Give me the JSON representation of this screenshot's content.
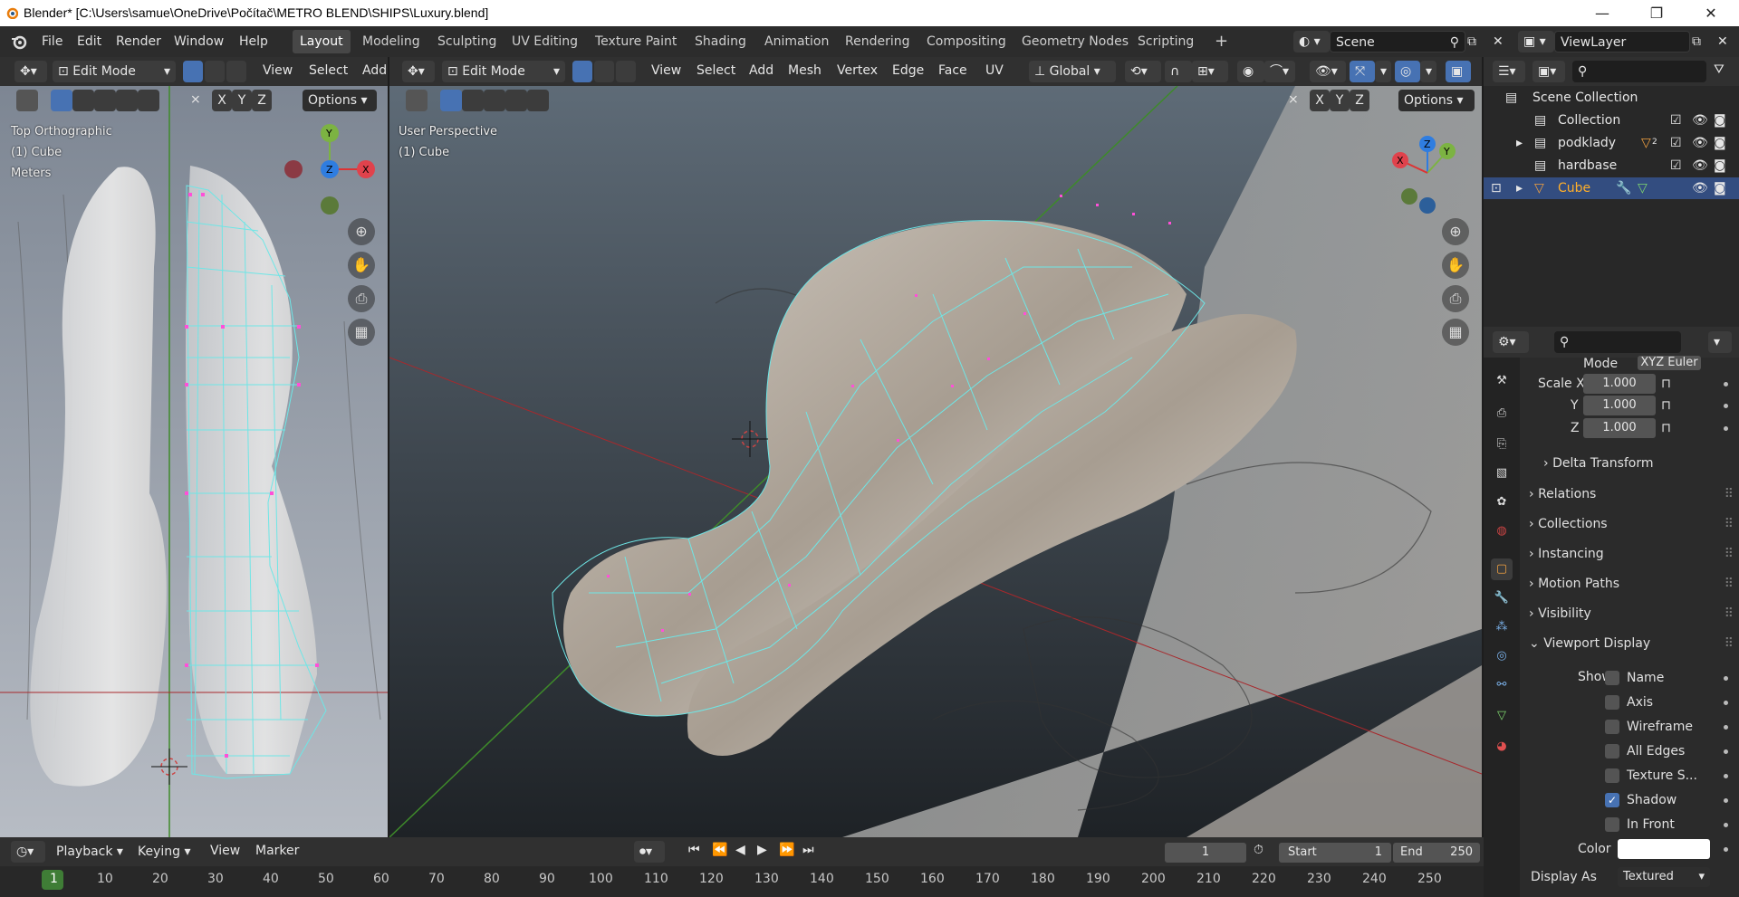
{
  "window": {
    "title": "Blender* [C:\\Users\\samue\\OneDrive\\Počítač\\METRO BLEND\\SHIPS\\Luxury.blend]",
    "controls": [
      "—",
      "❐",
      "✕"
    ]
  },
  "menu": [
    "File",
    "Edit",
    "Render",
    "Window",
    "Help"
  ],
  "workspaces": [
    "Layout",
    "Modeling",
    "Sculpting",
    "UV Editing",
    "Texture Paint",
    "Shading",
    "Animation",
    "Rendering",
    "Compositing",
    "Geometry Nodes",
    "Scripting",
    "+"
  ],
  "active_workspace": "Layout",
  "scene": {
    "label": "Scene",
    "view_layer": "ViewLayer"
  },
  "left_viewport": {
    "mode": "Edit Mode",
    "menus": [
      "View",
      "Select",
      "Add"
    ],
    "axes": [
      "X",
      "Y",
      "Z"
    ],
    "options": "Options",
    "view_name": "Top Orthographic",
    "object": "(1) Cube",
    "units": "Meters",
    "gizmo": {
      "y": "Y",
      "z": "Z",
      "x": "X"
    }
  },
  "main_viewport": {
    "mode": "Edit Mode",
    "menus": [
      "View",
      "Select",
      "Add",
      "Mesh",
      "Vertex",
      "Edge",
      "Face",
      "UV"
    ],
    "orientation": "Global",
    "axes": [
      "X",
      "Y",
      "Z"
    ],
    "options": "Options",
    "view_name": "User Perspective",
    "object": "(1) Cube",
    "gizmo": {
      "z": "Z",
      "y": "Y",
      "x": "X"
    }
  },
  "outliner": {
    "root": "Scene Collection",
    "items": [
      {
        "label": "Collection"
      },
      {
        "label": "podklady",
        "badge": "2"
      },
      {
        "label": "hardbase"
      },
      {
        "label": "Cube"
      }
    ]
  },
  "properties": {
    "mode_label": "Mode",
    "mode_value": "XYZ Euler",
    "scale_label": "Scale X",
    "y_label": "Y",
    "z_label": "Z",
    "scale_values": [
      "1.000",
      "1.000",
      "1.000"
    ],
    "panels": [
      "Delta Transform",
      "Relations",
      "Collections",
      "Instancing",
      "Motion Paths",
      "Visibility",
      "Viewport Display"
    ],
    "show_label": "Show",
    "show_options": [
      {
        "label": "Name",
        "checked": false
      },
      {
        "label": "Axis",
        "checked": false
      },
      {
        "label": "Wireframe",
        "checked": false
      },
      {
        "label": "All Edges",
        "checked": false
      },
      {
        "label": "Texture S...",
        "checked": false
      },
      {
        "label": "Shadow",
        "checked": true
      },
      {
        "label": "In Front",
        "checked": false
      }
    ],
    "color_label": "Color",
    "display_as_label": "Display As",
    "display_as_value": "Textured"
  },
  "timeline": {
    "menus": [
      "Playback",
      "Keying",
      "View",
      "Marker"
    ],
    "current_frame": "1",
    "start_label": "Start",
    "start": "1",
    "end_label": "End",
    "end": "250",
    "ticks": [
      "1",
      "10",
      "20",
      "30",
      "40",
      "50",
      "60",
      "70",
      "80",
      "90",
      "100",
      "110",
      "120",
      "130",
      "140",
      "150",
      "160",
      "170",
      "180",
      "190",
      "200",
      "210",
      "220",
      "230",
      "240",
      "250"
    ]
  },
  "colors": {
    "accent": "#4772b3",
    "wire": "#6ee6e6",
    "vertex": "#ff4fd8",
    "active_row": "#334d80"
  }
}
